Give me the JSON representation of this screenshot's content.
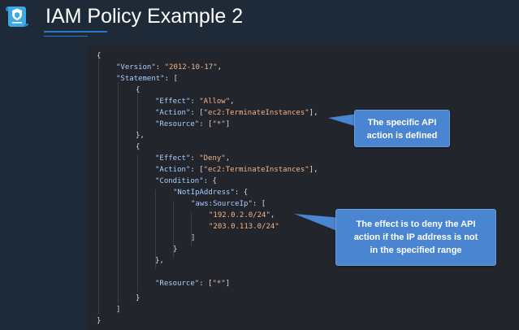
{
  "slide": {
    "title": "IAM Policy Example 2"
  },
  "colors": {
    "background": "#1f2a38",
    "code_background": "#22252b",
    "json_key": "#a8cfff",
    "json_string": "#f0b48a",
    "callout": "#4a85d1",
    "accent": "#2f76c8"
  },
  "icons": {
    "logo": "iam-policy-document-icon"
  },
  "code": {
    "t0": "{",
    "t1_k": "\"Version\"",
    "t1_p": ": ",
    "t1_s": "\"2012-10-17\"",
    "t1_e": ",",
    "t2_k": "\"Statement\"",
    "t2_p": ": [",
    "t3": "{",
    "t4_k": "\"Effect\"",
    "t4_p": ": ",
    "t4_s": "\"Allow\"",
    "t4_e": ",",
    "t5_k": "\"Action\"",
    "t5_p": ": [",
    "t5_s": "\"ec2:TerminateInstances\"",
    "t5_e": "],",
    "t6_k": "\"Resource\"",
    "t6_p": ": [",
    "t6_s": "\"*\"",
    "t6_e": "]",
    "t7": "},",
    "t8": "{",
    "t9_k": "\"Effect\"",
    "t9_p": ": ",
    "t9_s": "\"Deny\"",
    "t9_e": ",",
    "t10_k": "\"Action\"",
    "t10_p": ": [",
    "t10_s": "\"ec2:TerminateInstances\"",
    "t10_e": "],",
    "t11_k": "\"Condition\"",
    "t11_p": ": {",
    "t12_k": "\"NotIpAddress\"",
    "t12_p": ": {",
    "t13_k": "\"aws:SourceIp\"",
    "t13_p": ": [",
    "t14_s": "\"192.0.2.0/24\"",
    "t14_e": ",",
    "t15_s": "\"203.0.113.0/24\"",
    "t16": "]",
    "t17": "}",
    "t18": "},",
    "t19_k": "\"Resource\"",
    "t19_p": ": [",
    "t19_s": "\"*\"",
    "t19_e": "]",
    "t20": "}",
    "t21": "]",
    "t22": "}"
  },
  "callouts": {
    "api_action_line1": "The specific API",
    "api_action_line2": "action is defined",
    "deny_line1": "The effect is to deny the API",
    "deny_line2": "action if the IP address is not",
    "deny_line3": "in the specified range"
  }
}
